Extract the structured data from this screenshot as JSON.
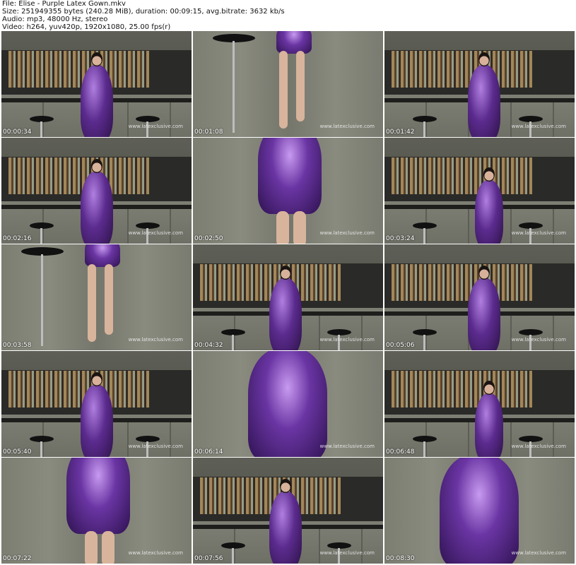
{
  "header": {
    "file": "File: Elise - Purple Latex Gown.mkv",
    "size": "Size: 251949355 bytes (240.28 MiB), duration: 00:09:15, avg.bitrate: 3632 kb/s",
    "audio": "Audio: mp3, 48000 Hz, stereo",
    "video": "Video: h264, yuv420p, 1920x1080, 25.00 fps(r)"
  },
  "watermark": "www.latexclusive.com",
  "thumbnails": [
    {
      "time": "00:00:34",
      "scene": "bar-wide"
    },
    {
      "time": "00:01:08",
      "scene": "legs-stool"
    },
    {
      "time": "00:01:42",
      "scene": "bar-back"
    },
    {
      "time": "00:02:16",
      "scene": "bar-wide"
    },
    {
      "time": "00:02:50",
      "scene": "skirt-close"
    },
    {
      "time": "00:03:24",
      "scene": "bar-lean"
    },
    {
      "time": "00:03:58",
      "scene": "legs-stool"
    },
    {
      "time": "00:04:32",
      "scene": "bar-pose"
    },
    {
      "time": "00:05:06",
      "scene": "bar-back"
    },
    {
      "time": "00:05:40",
      "scene": "bar-wide"
    },
    {
      "time": "00:06:14",
      "scene": "hips-close"
    },
    {
      "time": "00:06:48",
      "scene": "bar-lean"
    },
    {
      "time": "00:07:22",
      "scene": "skirt-close"
    },
    {
      "time": "00:07:56",
      "scene": "bar-pose"
    },
    {
      "time": "00:08:30",
      "scene": "hips-close"
    }
  ]
}
